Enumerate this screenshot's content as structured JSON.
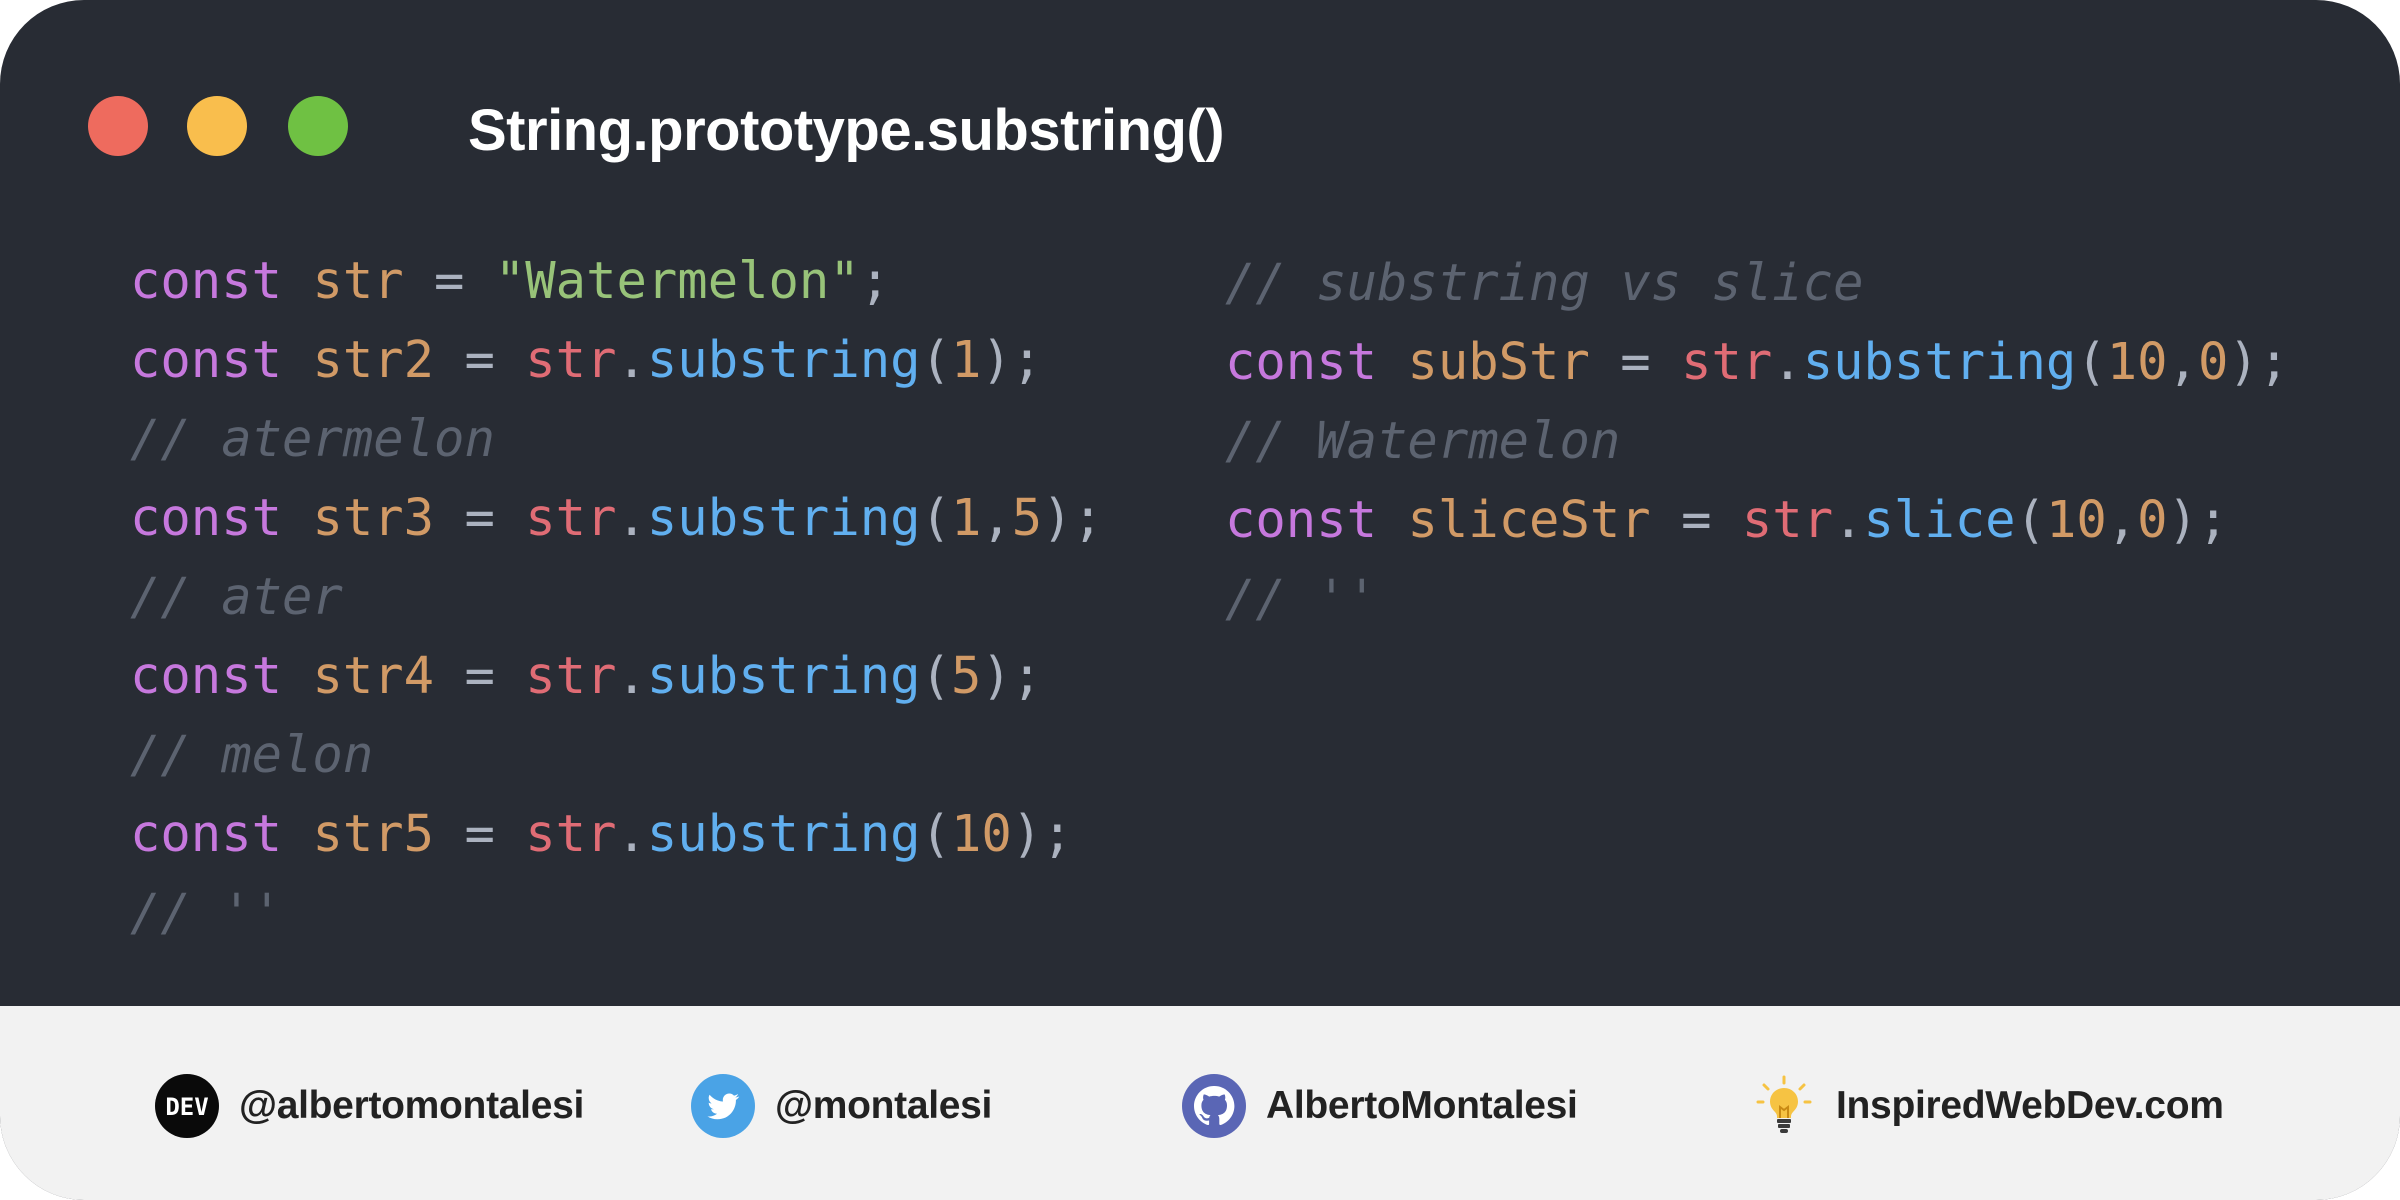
{
  "window": {
    "title": "String.prototype.substring()"
  },
  "code": {
    "left": [
      [
        {
          "t": "const",
          "c": "kw"
        },
        {
          "t": " ",
          "c": "op"
        },
        {
          "t": "str",
          "c": "var"
        },
        {
          "t": " = ",
          "c": "op"
        },
        {
          "t": "\"Watermelon\"",
          "c": "str"
        },
        {
          "t": ";",
          "c": "pun"
        }
      ],
      [
        {
          "t": "const",
          "c": "kw"
        },
        {
          "t": " ",
          "c": "op"
        },
        {
          "t": "str2",
          "c": "var"
        },
        {
          "t": " = ",
          "c": "op"
        },
        {
          "t": "str",
          "c": "obj"
        },
        {
          "t": ".",
          "c": "pun"
        },
        {
          "t": "substring",
          "c": "fn"
        },
        {
          "t": "(",
          "c": "pun"
        },
        {
          "t": "1",
          "c": "num"
        },
        {
          "t": ");",
          "c": "pun"
        }
      ],
      [
        {
          "t": "// atermelon",
          "c": "cm"
        }
      ],
      [
        {
          "t": "const",
          "c": "kw"
        },
        {
          "t": " ",
          "c": "op"
        },
        {
          "t": "str3",
          "c": "var"
        },
        {
          "t": " = ",
          "c": "op"
        },
        {
          "t": "str",
          "c": "obj"
        },
        {
          "t": ".",
          "c": "pun"
        },
        {
          "t": "substring",
          "c": "fn"
        },
        {
          "t": "(",
          "c": "pun"
        },
        {
          "t": "1",
          "c": "num"
        },
        {
          "t": ",",
          "c": "pun"
        },
        {
          "t": "5",
          "c": "num"
        },
        {
          "t": ");",
          "c": "pun"
        }
      ],
      [
        {
          "t": "// ater",
          "c": "cm"
        }
      ],
      [
        {
          "t": "const",
          "c": "kw"
        },
        {
          "t": " ",
          "c": "op"
        },
        {
          "t": "str4",
          "c": "var"
        },
        {
          "t": " = ",
          "c": "op"
        },
        {
          "t": "str",
          "c": "obj"
        },
        {
          "t": ".",
          "c": "pun"
        },
        {
          "t": "substring",
          "c": "fn"
        },
        {
          "t": "(",
          "c": "pun"
        },
        {
          "t": "5",
          "c": "num"
        },
        {
          "t": ");",
          "c": "pun"
        }
      ],
      [
        {
          "t": "// melon",
          "c": "cm"
        }
      ],
      [
        {
          "t": "const",
          "c": "kw"
        },
        {
          "t": " ",
          "c": "op"
        },
        {
          "t": "str5",
          "c": "var"
        },
        {
          "t": " = ",
          "c": "op"
        },
        {
          "t": "str",
          "c": "obj"
        },
        {
          "t": ".",
          "c": "pun"
        },
        {
          "t": "substring",
          "c": "fn"
        },
        {
          "t": "(",
          "c": "pun"
        },
        {
          "t": "10",
          "c": "num"
        },
        {
          "t": ");",
          "c": "pun"
        }
      ],
      [
        {
          "t": "// ''",
          "c": "cm"
        }
      ]
    ],
    "right": [
      [
        {
          "t": "// substring vs slice",
          "c": "cm"
        }
      ],
      [
        {
          "t": "const",
          "c": "kw"
        },
        {
          "t": " ",
          "c": "op"
        },
        {
          "t": "subStr",
          "c": "var"
        },
        {
          "t": " = ",
          "c": "op"
        },
        {
          "t": "str",
          "c": "obj"
        },
        {
          "t": ".",
          "c": "pun"
        },
        {
          "t": "substring",
          "c": "fn"
        },
        {
          "t": "(",
          "c": "pun"
        },
        {
          "t": "10",
          "c": "num"
        },
        {
          "t": ",",
          "c": "pun"
        },
        {
          "t": "0",
          "c": "num"
        },
        {
          "t": ");",
          "c": "pun"
        }
      ],
      [
        {
          "t": "// Watermelon",
          "c": "cm"
        }
      ],
      [
        {
          "t": "const",
          "c": "kw"
        },
        {
          "t": " ",
          "c": "op"
        },
        {
          "t": "sliceStr",
          "c": "var"
        },
        {
          "t": " = ",
          "c": "op"
        },
        {
          "t": "str",
          "c": "obj"
        },
        {
          "t": ".",
          "c": "pun"
        },
        {
          "t": "slice",
          "c": "fn"
        },
        {
          "t": "(",
          "c": "pun"
        },
        {
          "t": "10",
          "c": "num"
        },
        {
          "t": ",",
          "c": "pun"
        },
        {
          "t": "0",
          "c": "num"
        },
        {
          "t": ");",
          "c": "pun"
        }
      ],
      [
        {
          "t": "// ''",
          "c": "cm"
        }
      ]
    ]
  },
  "footer": {
    "dev": {
      "label": "@albertomontalesi",
      "icon": "dev-logo-icon",
      "badge": "DEV"
    },
    "twitter": {
      "label": "@montalesi",
      "icon": "twitter-bird-icon"
    },
    "github": {
      "label": "AlbertoMontalesi",
      "icon": "github-octocat-icon"
    },
    "website": {
      "label": "InspiredWebDev.com",
      "icon": "lightbulb-icon"
    }
  },
  "colors": {
    "background": "#282c34",
    "footer": "#f2f2f2",
    "dot_red": "#ee6b5e",
    "dot_yellow": "#f9be4d",
    "dot_green": "#6fc143",
    "keyword": "#c678dd",
    "variable": "#d19a66",
    "string": "#98c379",
    "object": "#e06c75",
    "function": "#61afef",
    "comment": "#5c6370"
  }
}
